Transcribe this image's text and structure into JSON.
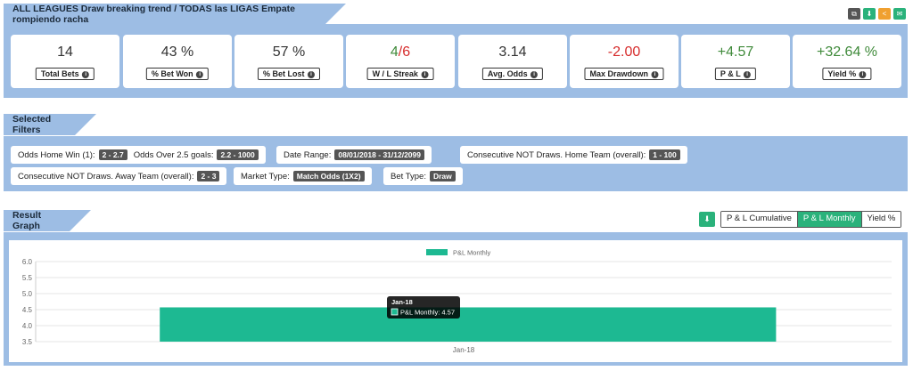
{
  "header": {
    "title": "ALL LEAGUES Draw breaking trend / TODAS las LIGAS Empate rompiendo racha",
    "buttons": [
      {
        "icon": "copy-icon",
        "color": "#555555"
      },
      {
        "icon": "download-icon",
        "color": "#2ab27b"
      },
      {
        "icon": "share-icon",
        "color": "#f0a030"
      },
      {
        "icon": "email-icon",
        "color": "#2ab27b"
      }
    ]
  },
  "stats": [
    {
      "value": "14",
      "label": "Total Bets",
      "tone": "neutral"
    },
    {
      "value": "43 %",
      "label": "% Bet Won",
      "tone": "neutral"
    },
    {
      "value": "57 %",
      "label": "% Bet Lost",
      "tone": "neutral"
    },
    {
      "value_win": "4",
      "value_sep": "/",
      "value_loss": "6",
      "label": "W / L Streak",
      "tone": "mixed"
    },
    {
      "value": "3.14",
      "label": "Avg. Odds",
      "tone": "neutral"
    },
    {
      "value": "-2.00",
      "label": "Max Drawdown",
      "tone": "red"
    },
    {
      "value": "+4.57",
      "label": "P & L",
      "tone": "green"
    },
    {
      "value": "+32.64 %",
      "label": "Yield %",
      "tone": "green"
    }
  ],
  "filters": {
    "title": "Selected Filters",
    "odds_home_label": "Odds Home Win (1):",
    "odds_home_value": "2 - 2.7",
    "odds_over_label": "Odds Over 2.5 goals:",
    "odds_over_value": "2.2 - 1000",
    "date_label": "Date Range:",
    "date_value": "08/01/2018 - 31/12/2099",
    "cons_home_label": "Consecutive NOT Draws. Home Team (overall):",
    "cons_home_value": "1 - 100",
    "cons_away_label": "Consecutive NOT Draws. Away Team (overall):",
    "cons_away_value": "2 - 3",
    "market_label": "Market Type:",
    "market_value": "Match Odds (1X2)",
    "bet_label": "Bet Type:",
    "bet_value": "Draw"
  },
  "graph": {
    "title": "Result Graph",
    "download_icon": "download-icon",
    "tabs": [
      "P & L Cumulative",
      "P & L Monthly",
      "Yield %"
    ],
    "active_tab": "P & L Monthly",
    "tooltip_title": "Jan-18",
    "tooltip_text": "P&L Monthly: 4.57"
  },
  "chart_data": {
    "type": "bar",
    "categories": [
      "Jan-18"
    ],
    "series": [
      {
        "name": "P&L Monthly",
        "values": [
          4.57
        ],
        "color": "#1db992"
      }
    ],
    "ylim": [
      3.5,
      6.0
    ],
    "yticks": [
      "6.0",
      "5.5",
      "5.0",
      "4.5",
      "4.0",
      "3.5"
    ],
    "legend": "top-center",
    "grid": true
  }
}
